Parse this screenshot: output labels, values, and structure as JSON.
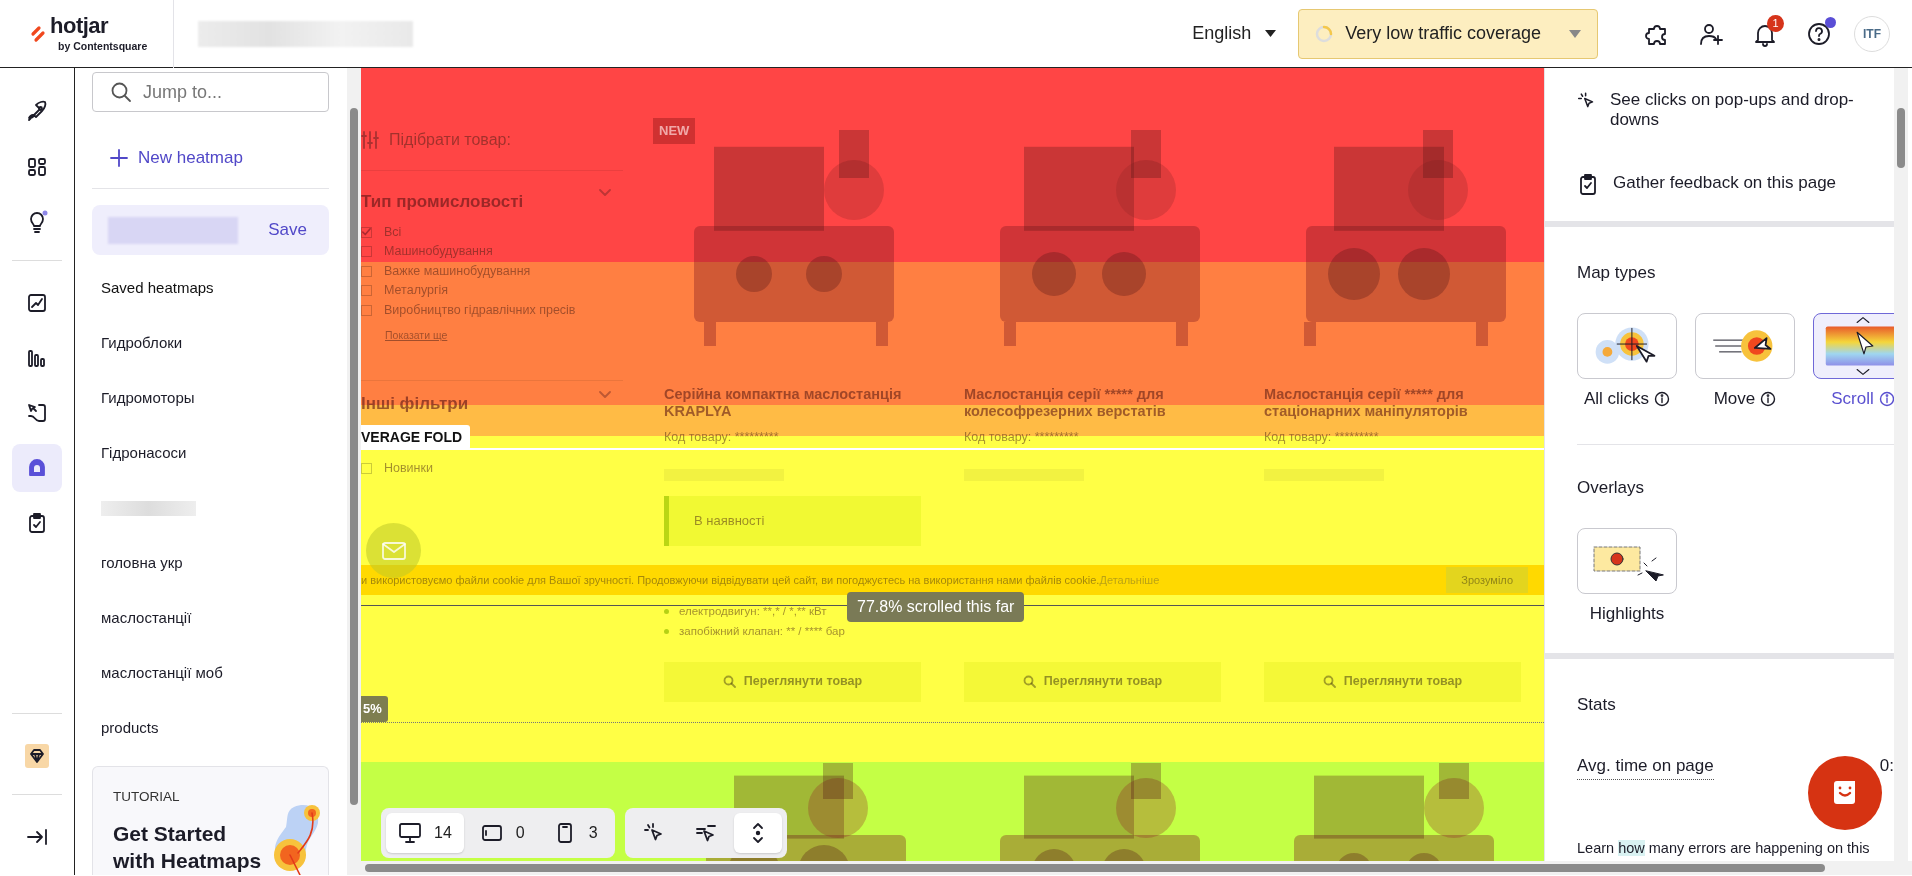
{
  "topbar": {
    "logo": "hotjar",
    "logo_sub": "by Contentsquare",
    "language": "English",
    "coverage": "Very low traffic coverage",
    "notifications": "1",
    "avatar": "ITF"
  },
  "rail_groups": [
    [
      {
        "selected": false
      },
      {
        "selected": false
      },
      {
        "selected": false
      }
    ],
    [
      {
        "selected": false
      },
      {
        "selected": false
      },
      {
        "selected": false
      },
      {
        "selected": true
      },
      {
        "selected": false
      }
    ],
    [
      {
        "selected": false
      }
    ],
    [
      {
        "selected": false
      }
    ]
  ],
  "sidebar": {
    "search_placeholder": "Jump to...",
    "new_button": "New heatmap",
    "save_button": "Save",
    "items": [
      {
        "kind": "heading",
        "label": "Saved heatmaps"
      },
      {
        "kind": "link",
        "label": "Гидроблоки"
      },
      {
        "kind": "link",
        "label": "Гидромоторы"
      },
      {
        "kind": "link",
        "label": "Гідронасоси"
      },
      {
        "kind": "blurred"
      },
      {
        "kind": "link",
        "label": "головна укр"
      },
      {
        "kind": "link",
        "label": "маслостанції"
      },
      {
        "kind": "link",
        "label": "маслостанції моб"
      },
      {
        "kind": "link",
        "label": "products"
      }
    ],
    "tutorial": {
      "eyebrow": "TUTORIAL",
      "title": "Get Started with Heatmaps"
    }
  },
  "site": {
    "filter_title": "Підібрати товар:",
    "group_title": "Тип промисловості",
    "options": [
      {
        "label": "Всі",
        "checked": true
      },
      {
        "label": "Машинобудування",
        "checked": false
      },
      {
        "label": "Важке машинобудування",
        "checked": false
      },
      {
        "label": "Металургія",
        "checked": false
      },
      {
        "label": "Виробництво гідравлічних пресів",
        "checked": false
      }
    ],
    "show_more": "Показати ще",
    "other_filters": "Інші фільтри",
    "extra_options": [
      {
        "label": "Новинки",
        "checked": false
      }
    ],
    "products": [
      {
        "badge": "NEW",
        "title": "Серійна компактна маслостанція KRAPLYA",
        "code": "Код товару: *********",
        "availability": "В наявності",
        "specs": [
          "електродвигун: **,* / *,** кВт",
          "запобіжний клапан: ** / **** бар"
        ],
        "button": "Переглянути товар"
      },
      {
        "title": "Маслостанція серії ***** для колесофрезерних верстатів",
        "code": "Код товару: *********",
        "button": "Переглянути товар"
      },
      {
        "title": "Маслостанція серії ***** для стаціонарних маніпуляторів",
        "code": "Код товару: *********",
        "button": "Переглянути товар"
      }
    ],
    "cookie": {
      "text": "и використовуємо файли cookie для Вашої зручності. Продовжуючи відвідувати цей сайт, ви погоджуєтесь на використання нами файлів cookie.",
      "link": "Детальніше",
      "button": "Зрозуміло"
    }
  },
  "heatmap": {
    "fold_label": "VERAGE FOLD",
    "reach_label": "77.8% scrolled this far",
    "edge_label": "5%"
  },
  "device_tabs": [
    {
      "count": "14",
      "selected": true
    },
    {
      "count": "0",
      "selected": false
    },
    {
      "count": "3",
      "selected": false
    }
  ],
  "map_tools": [
    {
      "selected": false
    },
    {
      "selected": false
    },
    {
      "selected": true
    }
  ],
  "panel": {
    "actions": [
      "See clicks on pop-ups and drop-downs",
      "Gather feedback on this page"
    ],
    "map_types_title": "Map types",
    "map_types": [
      {
        "label": "All clicks",
        "selected": false
      },
      {
        "label": "Move",
        "selected": false
      },
      {
        "label": "Scroll",
        "selected": true
      }
    ],
    "overlays_title": "Overlays",
    "overlays": [
      {
        "label": "Highlights"
      }
    ],
    "stats_title": "Stats",
    "stats": [
      {
        "label": "Avg. time on page",
        "value": "0:"
      }
    ],
    "note_before": "Learn ",
    "note_link": "how",
    "note_after": " many errors are happening on this"
  }
}
